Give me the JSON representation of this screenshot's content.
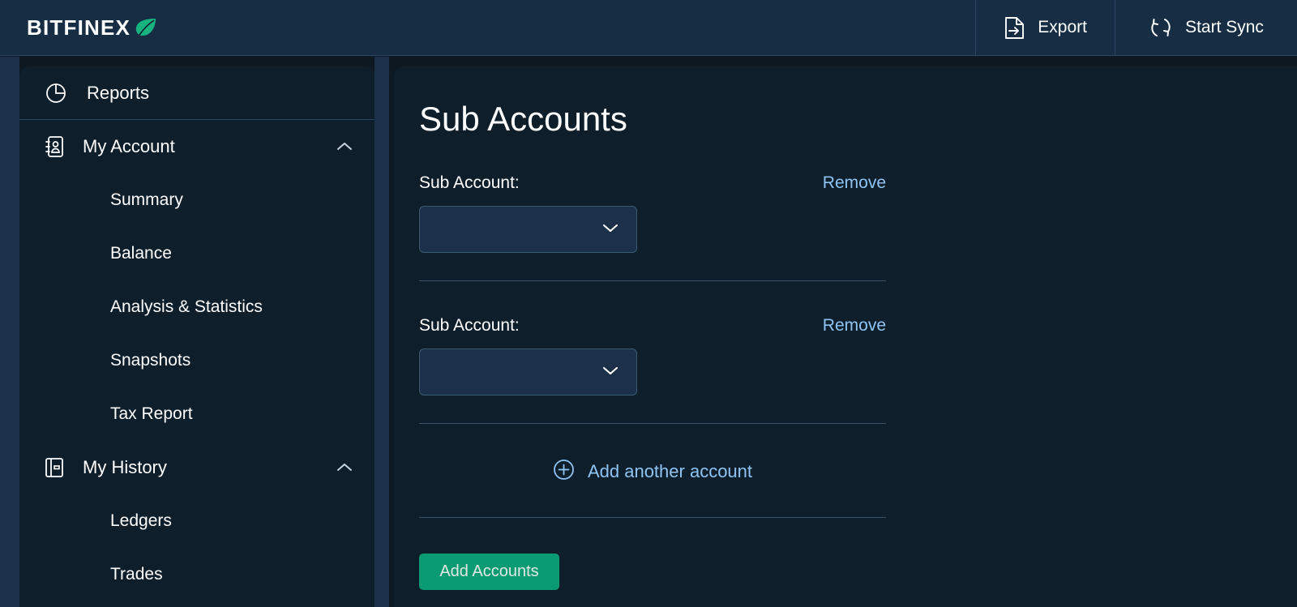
{
  "header": {
    "brand": "BITFINEX",
    "brand_leaf_icon": "leaf-icon",
    "actions": [
      {
        "label": "Export",
        "icon": "file-export-icon"
      },
      {
        "label": "Start Sync",
        "icon": "sync-refresh-icon"
      }
    ]
  },
  "sidebar": {
    "top_item": {
      "label": "Reports",
      "icon": "pie-chart-icon"
    },
    "groups": [
      {
        "label": "My Account",
        "icon": "address-book-icon",
        "chevron": "chevron-up-icon",
        "expanded": true,
        "items": [
          {
            "label": "Summary"
          },
          {
            "label": "Balance"
          },
          {
            "label": "Analysis & Statistics"
          },
          {
            "label": "Snapshots"
          },
          {
            "label": "Tax Report"
          }
        ]
      },
      {
        "label": "My History",
        "icon": "book-icon",
        "chevron": "chevron-up-icon",
        "expanded": true,
        "items": [
          {
            "label": "Ledgers"
          },
          {
            "label": "Trades"
          }
        ]
      }
    ]
  },
  "main": {
    "title": "Sub Accounts",
    "rows": [
      {
        "label": "Sub Account:",
        "remove_label": "Remove",
        "select_value": "",
        "select_icon": "chevron-down-icon"
      },
      {
        "label": "Sub Account:",
        "remove_label": "Remove",
        "select_value": "",
        "select_icon": "chevron-down-icon"
      }
    ],
    "add_another": {
      "label": "Add another account",
      "icon": "plus-circle-icon"
    },
    "submit_label": "Add Accounts"
  },
  "colors": {
    "page_bg": "#0d1820",
    "header_bg": "#172d44",
    "panel_bg": "#0f1e2b",
    "accent_green": "#0b9b72",
    "link_blue": "#8ec5f5",
    "field_bg": "#1c3049",
    "border": "#2b4763"
  }
}
